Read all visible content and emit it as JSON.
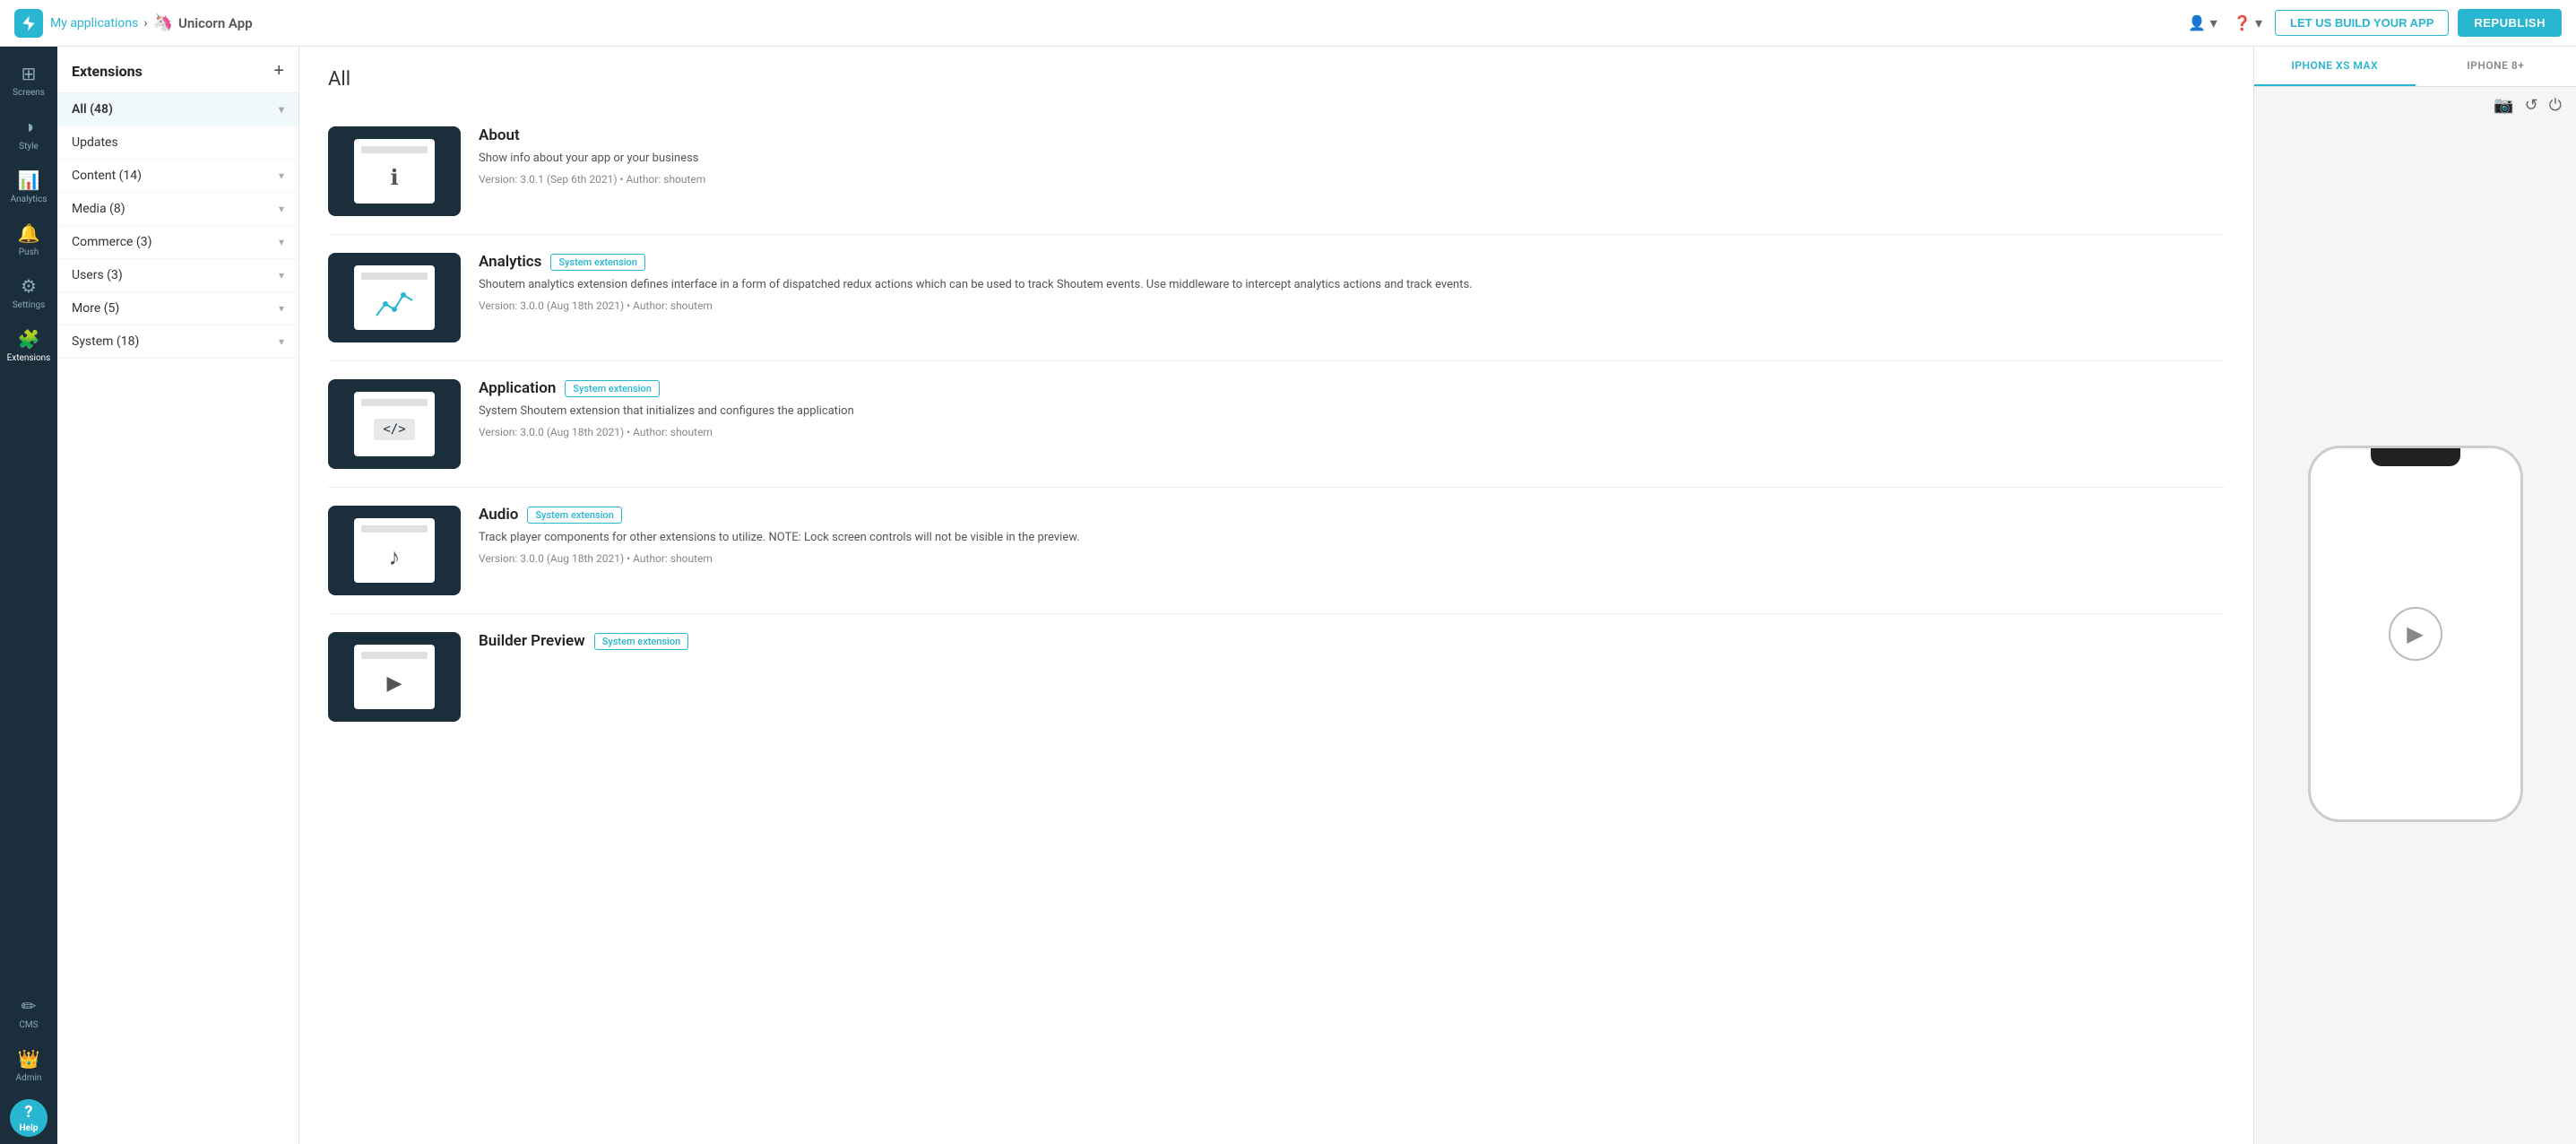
{
  "topbar": {
    "breadcrumb_link": "My applications",
    "separator": "›",
    "app_name": "Unicorn App",
    "app_icon": "🦄",
    "btn_build_label": "LET US BUILD YOUR APP",
    "btn_republish_label": "REPUBLISH"
  },
  "icon_sidebar": {
    "items": [
      {
        "id": "screens",
        "label": "Screens",
        "icon": "⊞"
      },
      {
        "id": "style",
        "label": "Style",
        "icon": "🎨"
      },
      {
        "id": "analytics",
        "label": "Analytics",
        "icon": "📈"
      },
      {
        "id": "push",
        "label": "Push",
        "icon": "👤"
      },
      {
        "id": "settings",
        "label": "Settings",
        "icon": "⚙"
      },
      {
        "id": "extensions",
        "label": "Extensions",
        "icon": "🧩"
      },
      {
        "id": "cms",
        "label": "CMS",
        "icon": "✏"
      },
      {
        "id": "admin",
        "label": "Admin",
        "icon": "👑"
      }
    ],
    "help_label": "Help"
  },
  "panel_sidebar": {
    "title": "Extensions",
    "categories": [
      {
        "id": "all",
        "label": "All (48)",
        "active": true,
        "count": 48
      },
      {
        "id": "updates",
        "label": "Updates",
        "active": false,
        "count": null
      },
      {
        "id": "content",
        "label": "Content (14)",
        "active": false,
        "count": 14,
        "has_arrow": true
      },
      {
        "id": "media",
        "label": "Media (8)",
        "active": false,
        "count": 8,
        "has_arrow": true
      },
      {
        "id": "commerce",
        "label": "Commerce (3)",
        "active": false,
        "count": 3,
        "has_arrow": true
      },
      {
        "id": "users",
        "label": "Users (3)",
        "active": false,
        "count": 3,
        "has_arrow": true
      },
      {
        "id": "more",
        "label": "More (5)",
        "active": false,
        "count": 5,
        "has_arrow": true
      },
      {
        "id": "system",
        "label": "System (18)",
        "active": false,
        "count": 18,
        "has_arrow": true
      }
    ]
  },
  "main": {
    "section_title": "All",
    "extensions": [
      {
        "id": "about",
        "name": "About",
        "badge": null,
        "description": "Show info about your app or your business",
        "meta": "Version: 3.0.1 (Sep 6th 2021) • Author: shoutem",
        "thumb_icon": "ℹ",
        "thumb_type": "info"
      },
      {
        "id": "analytics",
        "name": "Analytics",
        "badge": "System extension",
        "description": "Shoutem analytics extension defines interface in a form of dispatched redux actions which can be used to track Shoutem events. Use middleware to intercept analytics actions and track events.",
        "meta": "Version: 3.0.0 (Aug 18th 2021) • Author: shoutem",
        "thumb_icon": "📈",
        "thumb_type": "chart"
      },
      {
        "id": "application",
        "name": "Application",
        "badge": "System extension",
        "description": "System Shoutem extension that initializes and configures the application",
        "meta": "Version: 3.0.0 (Aug 18th 2021) • Author: shoutem",
        "thumb_icon": "</>",
        "thumb_type": "code"
      },
      {
        "id": "audio",
        "name": "Audio",
        "badge": "System extension",
        "description": "Track player components for other extensions to utilize. NOTE: Lock screen controls will not be visible in the preview.",
        "meta": "Version: 3.0.0 (Aug 18th 2021) • Author: shoutem",
        "thumb_icon": "♪",
        "thumb_type": "music"
      },
      {
        "id": "builder-preview",
        "name": "Builder Preview",
        "badge": "System extension",
        "description": "",
        "meta": "",
        "thumb_icon": "▶",
        "thumb_type": "preview"
      }
    ]
  },
  "preview_panel": {
    "tabs": [
      {
        "id": "xs-max",
        "label": "IPHONE XS MAX",
        "active": true
      },
      {
        "id": "8plus",
        "label": "IPHONE 8+",
        "active": false
      }
    ]
  }
}
